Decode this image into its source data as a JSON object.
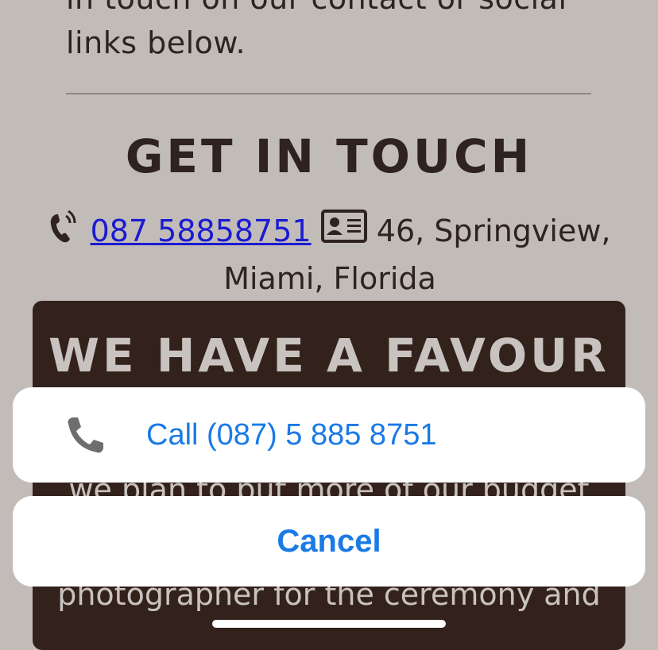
{
  "page": {
    "intro_text": "in touch on our contact or social links below.",
    "get_in_touch_heading": "GET IN TOUCH",
    "phone_link_text": "087 58858751",
    "address_text": "46, Springview, Miami, Florida",
    "favour_heading": "WE HAVE A FAVOUR",
    "favour_body": "we plan to put more of our budget into catering so have only booked a photographer for the ceremony and"
  },
  "action_sheet": {
    "call_label": "Call (087) 5 885 8751",
    "cancel_label": "Cancel"
  },
  "icons": {
    "phone": "phone-ringing-icon",
    "address": "address-card-icon",
    "call": "phone-handset-icon"
  },
  "colors": {
    "page_background": "#c2bcb9",
    "dark_card": "#33221c",
    "link": "#1b1bd1",
    "sheet_action_text": "#1a7ae6"
  }
}
